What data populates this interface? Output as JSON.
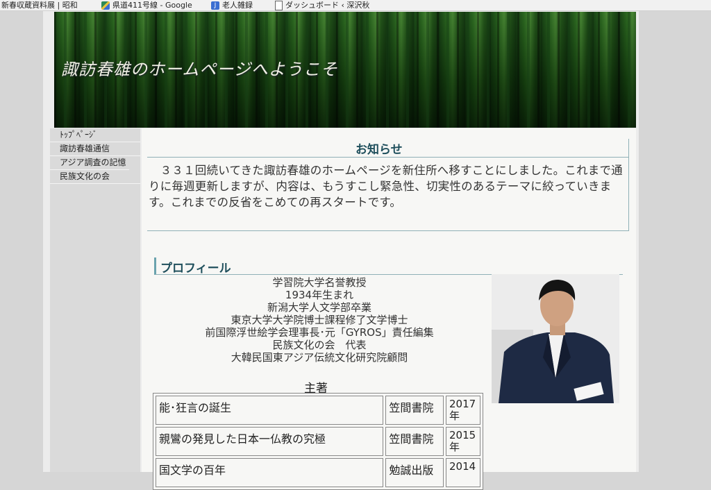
{
  "bookmarks": [
    {
      "label": "新春収蔵資料展 | 昭和",
      "icon": "doc-icon"
    },
    {
      "label": "県道411号線 - Google",
      "icon": "maps-icon"
    },
    {
      "label": "老人雑録",
      "icon": "j-icon"
    },
    {
      "label": "ダッシュボード ‹ 深沢秋",
      "icon": "doc-icon"
    }
  ],
  "header": {
    "title": "諏訪春雄のホームページへようこそ"
  },
  "sidebar": {
    "items": [
      {
        "label": "ﾄｯﾌﾟﾍﾟｰｼﾞ"
      },
      {
        "label": "諏訪春雄通信"
      },
      {
        "label": "アジア調査の記憶"
      },
      {
        "label": "民族文化の会"
      }
    ]
  },
  "notice": {
    "title": "お知らせ",
    "body": "　３３１回続いてきた諏訪春雄のホームページを新住所へ移すことにしました。これまで通りに毎週更新しますが、内容は、もうすこし緊急性、切実性のあるテーマに絞っていきます。これまでの反省をこめての再スタートです。"
  },
  "profile": {
    "title": "プロフィール",
    "lines": [
      "学習院大学名誉教授",
      "1934年生まれ",
      "新潟大学人文学部卒業",
      "東京大学大学院博士課程修了文学博士",
      "前国際浮世絵学会理事長･元「GYROS」責任編集",
      "民族文化の会　代表",
      "大韓民国東アジア伝統文化研究院顧問"
    ]
  },
  "works": {
    "title": "主著",
    "rows": [
      {
        "title": "能･狂言の誕生",
        "publisher": "笠間書院",
        "year": "2017年"
      },
      {
        "title": "親鸞の発見した日本一仏教の究極",
        "publisher": "笠間書院",
        "year": "2015年"
      },
      {
        "title": "国文学の百年",
        "publisher": "勉誠出版",
        "year": "2014"
      }
    ]
  },
  "colors": {
    "accent": "#1f4f5c",
    "rule": "#8fb0b6",
    "sidebar": "#dadada"
  }
}
